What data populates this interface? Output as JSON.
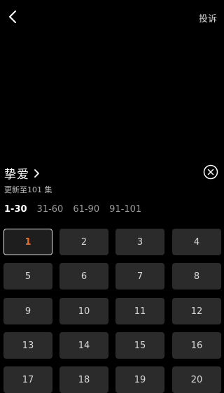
{
  "header": {
    "report_label": "投诉"
  },
  "drama": {
    "title": "挚爱",
    "update_text": "更新至101 集"
  },
  "range_tabs": [
    {
      "label": "1-30",
      "active": true
    },
    {
      "label": "31-60",
      "active": false
    },
    {
      "label": "61-90",
      "active": false
    },
    {
      "label": "91-101",
      "active": false
    }
  ],
  "episodes": {
    "current": "1",
    "items": [
      "1",
      "2",
      "3",
      "4",
      "5",
      "6",
      "7",
      "8",
      "9",
      "10",
      "11",
      "12",
      "13",
      "14",
      "15",
      "16",
      "17",
      "18",
      "19",
      "20"
    ]
  },
  "colors": {
    "background": "#000000",
    "tile": "#2b2b2b",
    "current_text": "#f26a1b",
    "current_border": "#e6e6e6",
    "muted_text": "#9a9a9a"
  },
  "icons": {
    "back": "back-arrow-icon",
    "title_more": "chevron-right-icon",
    "close": "close-circle-icon"
  }
}
